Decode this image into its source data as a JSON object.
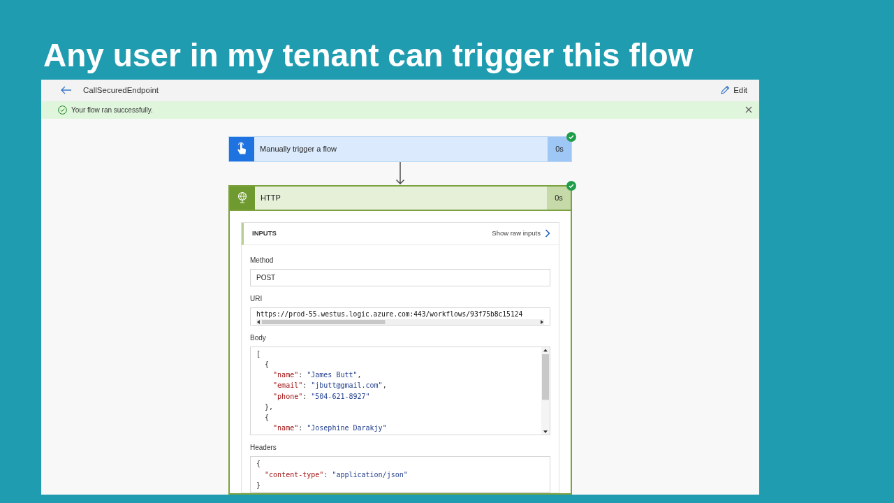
{
  "slide_title": "Any user in my tenant can trigger this flow",
  "header": {
    "title": "CallSecuredEndpoint",
    "edit_label": "Edit"
  },
  "notification": {
    "kind": "success",
    "message": "Your flow ran successfully."
  },
  "steps": [
    {
      "kind": "trigger",
      "title": "Manually trigger a flow",
      "duration": "0s",
      "succeeded": true
    },
    {
      "kind": "http",
      "title": "HTTP",
      "duration": "0s",
      "succeeded": true,
      "inputs": {
        "title": "INPUTS",
        "raw_link": "Show raw inputs",
        "fields": [
          {
            "label": "Method",
            "kind": "text",
            "value": "POST"
          },
          {
            "label": "URI",
            "kind": "url",
            "value": "https://prod-55.westus.logic.azure.com:443/workflows/93f75b8c15124"
          },
          {
            "label": "Body",
            "kind": "code",
            "lines": [
              [
                {
                  "kind": "punct",
                  "text": "["
                }
              ],
              [
                {
                  "kind": "punct",
                  "text": "  {"
                }
              ],
              [
                {
                  "kind": "key",
                  "text": "    \"name\""
                },
                {
                  "kind": "punct",
                  "text": ": "
                },
                {
                  "kind": "string",
                  "text": "\"James Butt\""
                },
                {
                  "kind": "punct",
                  "text": ","
                }
              ],
              [
                {
                  "kind": "key",
                  "text": "    \"email\""
                },
                {
                  "kind": "punct",
                  "text": ": "
                },
                {
                  "kind": "string",
                  "text": "\"jbutt@gmail.com\""
                },
                {
                  "kind": "punct",
                  "text": ","
                }
              ],
              [
                {
                  "kind": "key",
                  "text": "    \"phone\""
                },
                {
                  "kind": "punct",
                  "text": ": "
                },
                {
                  "kind": "string",
                  "text": "\"504-621-8927\""
                }
              ],
              [
                {
                  "kind": "punct",
                  "text": "  },"
                }
              ],
              [
                {
                  "kind": "punct",
                  "text": "  {"
                }
              ],
              [
                {
                  "kind": "key",
                  "text": "    \"name\""
                },
                {
                  "kind": "punct",
                  "text": ": "
                },
                {
                  "kind": "string",
                  "text": "\"Josephine Darakjy\""
                }
              ]
            ]
          },
          {
            "label": "Headers",
            "kind": "code",
            "lines": [
              [
                {
                  "kind": "punct",
                  "text": "{"
                }
              ],
              [
                {
                  "kind": "key",
                  "text": "  \"content-type\""
                },
                {
                  "kind": "punct",
                  "text": ": "
                },
                {
                  "kind": "string",
                  "text": "\"application/json\""
                }
              ],
              [
                {
                  "kind": "punct",
                  "text": "}"
                }
              ]
            ]
          }
        ]
      }
    }
  ]
}
